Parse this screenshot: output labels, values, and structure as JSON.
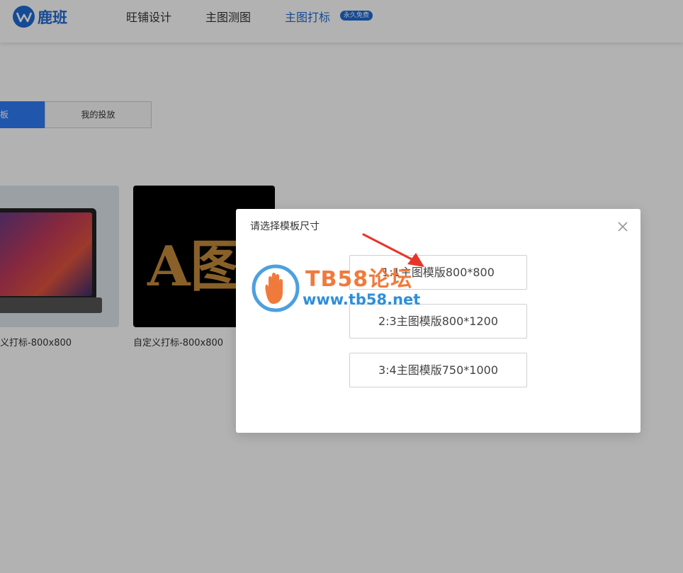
{
  "header": {
    "brand": "鹿班",
    "nav": [
      {
        "label": "旺铺设计"
      },
      {
        "label": "主图测图"
      },
      {
        "label": "主图打标"
      }
    ],
    "badge": "永久免费"
  },
  "tabs": {
    "active_label": "板",
    "other_label": "我的投放"
  },
  "cards": [
    {
      "label": "义打标-800x800"
    },
    {
      "label": "自定义打标-800x800",
      "preview_text": "A图"
    }
  ],
  "dialog": {
    "title": "请选择模板尺寸",
    "options": [
      {
        "label": "1:1主图模版800*800"
      },
      {
        "label": "2:3主图模版800*1200"
      },
      {
        "label": "3:4主图模版750*1000"
      }
    ]
  },
  "watermark": {
    "title": "TB58论坛",
    "url": "www.tb58.net"
  },
  "colors": {
    "brand_blue": "#1f6bd6",
    "watermark_orange": "#f07a3c",
    "arrow_red": "#e8352b"
  }
}
